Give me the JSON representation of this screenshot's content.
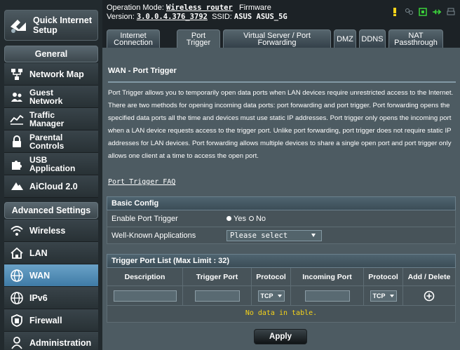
{
  "quick_setup": {
    "label": "Quick Internet Setup"
  },
  "sidebar": {
    "general_header": "General",
    "general_items": [
      {
        "label": "Network Map"
      },
      {
        "label": "Guest Network"
      },
      {
        "label": "Traffic Manager"
      },
      {
        "label": "Parental Controls"
      },
      {
        "label": "USB Application"
      },
      {
        "label": "AiCloud 2.0"
      }
    ],
    "advanced_header": "Advanced Settings",
    "advanced_items": [
      {
        "label": "Wireless"
      },
      {
        "label": "LAN"
      },
      {
        "label": "WAN",
        "active": true
      },
      {
        "label": "IPv6"
      },
      {
        "label": "Firewall"
      },
      {
        "label": "Administration"
      }
    ]
  },
  "header": {
    "op_mode_label": "Operation Mode:",
    "op_mode_value": "Wireless router",
    "firmware_label": "Firmware",
    "version_label": "Version:",
    "version_value": "3.0.0.4.376_3792",
    "ssid_label": "SSID:",
    "ssid_value": "ASUS  ASUS_5G"
  },
  "tabs": [
    {
      "label_line1": "Internet",
      "label_line2": "Connection"
    },
    {
      "label_line1": "Port",
      "label_line2": "Trigger",
      "active": true
    },
    {
      "label_line1": "Virtual Server / Port",
      "label_line2": "Forwarding"
    },
    {
      "label_line1": "DMZ",
      "label_line2": ""
    },
    {
      "label_line1": "DDNS",
      "label_line2": ""
    },
    {
      "label_line1": "NAT",
      "label_line2": "Passthrough"
    }
  ],
  "page": {
    "title": "WAN - Port Trigger",
    "description": "Port Trigger allows you to temporarily open data ports when LAN devices require unrestricted access to the Internet. There are two methods for opening incoming data ports: port forwarding and port trigger. Port forwarding opens the specified data ports all the time and devices must use static IP addresses. Port trigger only opens the incoming port when a LAN device requests access to the trigger port. Unlike port forwarding, port trigger does not require static IP addresses for LAN devices. Port forwarding allows multiple devices to share a single open port and port trigger only allows one client at a time to access the open port.",
    "faq_link": "Port Trigger FAQ"
  },
  "basic_config": {
    "header": "Basic Config",
    "enable_label": "Enable Port Trigger",
    "yes_label": "Yes",
    "no_label": "No",
    "selected": "Yes",
    "apps_label": "Well-Known Applications",
    "apps_select": "Please select"
  },
  "trigger_list": {
    "header": "Trigger Port List (Max Limit : 32)",
    "columns": [
      "Description",
      "Trigger Port",
      "Protocol",
      "Incoming Port",
      "Protocol",
      "Add / Delete"
    ],
    "protocol1": "TCP",
    "protocol2": "TCP",
    "empty_text": "No data in table."
  },
  "apply_label": "Apply",
  "colors": {
    "accent": "#f5d31a",
    "active_nav": "#5a93bb",
    "panel": "#4d5b62"
  }
}
